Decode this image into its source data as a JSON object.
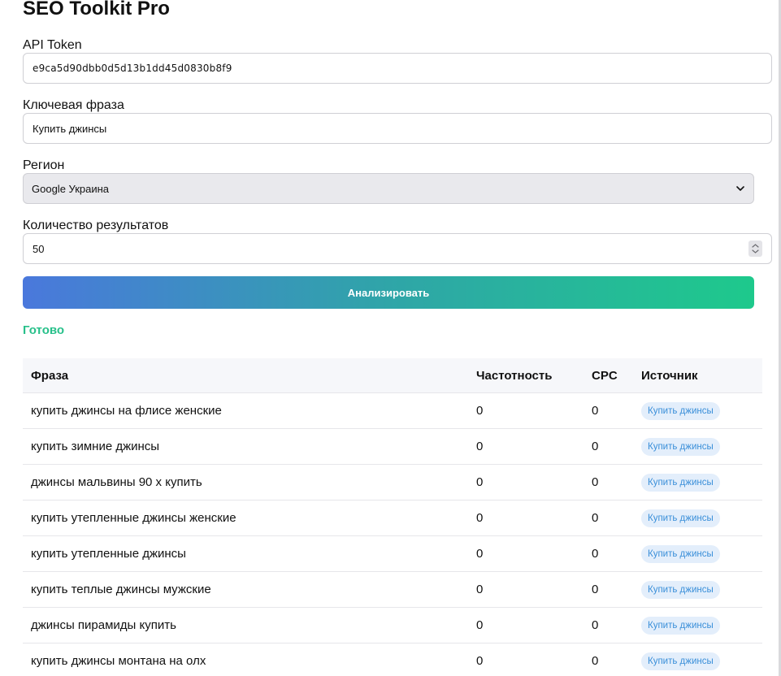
{
  "app": {
    "title": "SEO Toolkit Pro"
  },
  "form": {
    "token": {
      "label": "API Token",
      "value": "e9ca5d90dbb0d5d13b1dd45d0830b8f9"
    },
    "keyword": {
      "label": "Ключевая фраза",
      "value": "Купить джинсы"
    },
    "region": {
      "label": "Регион",
      "selected": "Google Украина"
    },
    "count": {
      "label": "Количество результатов",
      "value": "50"
    },
    "analyze_label": "Анализировать"
  },
  "status": {
    "text": "Готово",
    "color": "#27c08a"
  },
  "colors": {
    "badge_bg": "#e3eefb",
    "badge_text": "#3a8fd9",
    "status": "#27c08a",
    "button_gradient": [
      "#4a78dc",
      "#1ec98c"
    ]
  },
  "table": {
    "headers": {
      "phrase": "Фраза",
      "frequency": "Частотность",
      "cpc": "CPC",
      "source": "Источник"
    },
    "rows": [
      {
        "phrase": "купить джинсы на флисе женские",
        "frequency": "0",
        "cpc": "0",
        "source": "Купить джинсы"
      },
      {
        "phrase": "купить зимние джинсы",
        "frequency": "0",
        "cpc": "0",
        "source": "Купить джинсы"
      },
      {
        "phrase": "джинсы мальвины 90 х купить",
        "frequency": "0",
        "cpc": "0",
        "source": "Купить джинсы"
      },
      {
        "phrase": "купить утепленные джинсы женские",
        "frequency": "0",
        "cpc": "0",
        "source": "Купить джинсы"
      },
      {
        "phrase": "купить утепленные джинсы",
        "frequency": "0",
        "cpc": "0",
        "source": "Купить джинсы"
      },
      {
        "phrase": "купить теплые джинсы мужские",
        "frequency": "0",
        "cpc": "0",
        "source": "Купить джинсы"
      },
      {
        "phrase": "джинсы пирамиды купить",
        "frequency": "0",
        "cpc": "0",
        "source": "Купить джинсы"
      },
      {
        "phrase": "купить джинсы монтана на олх",
        "frequency": "0",
        "cpc": "0",
        "source": "Купить джинсы"
      }
    ]
  },
  "icons": {
    "select_arrow": "chevron-down-icon",
    "number_spinner": "spinner-icon"
  }
}
